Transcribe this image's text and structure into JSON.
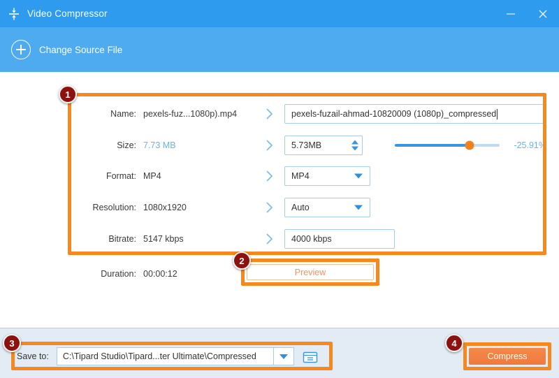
{
  "window": {
    "title": "Video Compressor",
    "icon": "compress-icon",
    "minimize_label": "—",
    "close_label": "✕"
  },
  "toolbar": {
    "change_source_label": "Change Source File",
    "plus_icon": "plus-circle-icon"
  },
  "form": {
    "rows": [
      {
        "label": "Name:",
        "value": "pexels-fuz...1080p).mp4"
      },
      {
        "label": "Size:",
        "value": "7.73 MB"
      },
      {
        "label": "Format:",
        "value": "MP4"
      },
      {
        "label": "Resolution:",
        "value": "1080x1920"
      },
      {
        "label": "Bitrate:",
        "value": "5147 kbps"
      }
    ],
    "name_input": "pexels-fuzail-ahmad-10820009 (1080p)_compressed",
    "size_input": "5.73MB",
    "format_select": "MP4",
    "resolution_select": "Auto",
    "bitrate_input": "4000 kbps",
    "slider": {
      "percent": 71,
      "label": "-25.91%"
    },
    "duration_label": "Duration:",
    "duration_value": "00:00:12",
    "preview_label": "Preview"
  },
  "bottom": {
    "save_to_label": "Save to:",
    "save_path": "C:\\Tipard Studio\\Tipard...ter Ultimate\\Compressed",
    "dropdown_icon": "chevron-down-icon",
    "folder_icon": "folder-icon",
    "compress_label": "Compress"
  },
  "annotations": {
    "badges": [
      "1",
      "2",
      "3",
      "4"
    ]
  },
  "colors": {
    "title_bar": "#2e9bef",
    "toolbar": "#4fabef",
    "accent_orange": "#f5881f",
    "badge_red": "#8c1210",
    "link_blue": "#69b3e7",
    "bottom_bar": "#e3ecf4"
  }
}
